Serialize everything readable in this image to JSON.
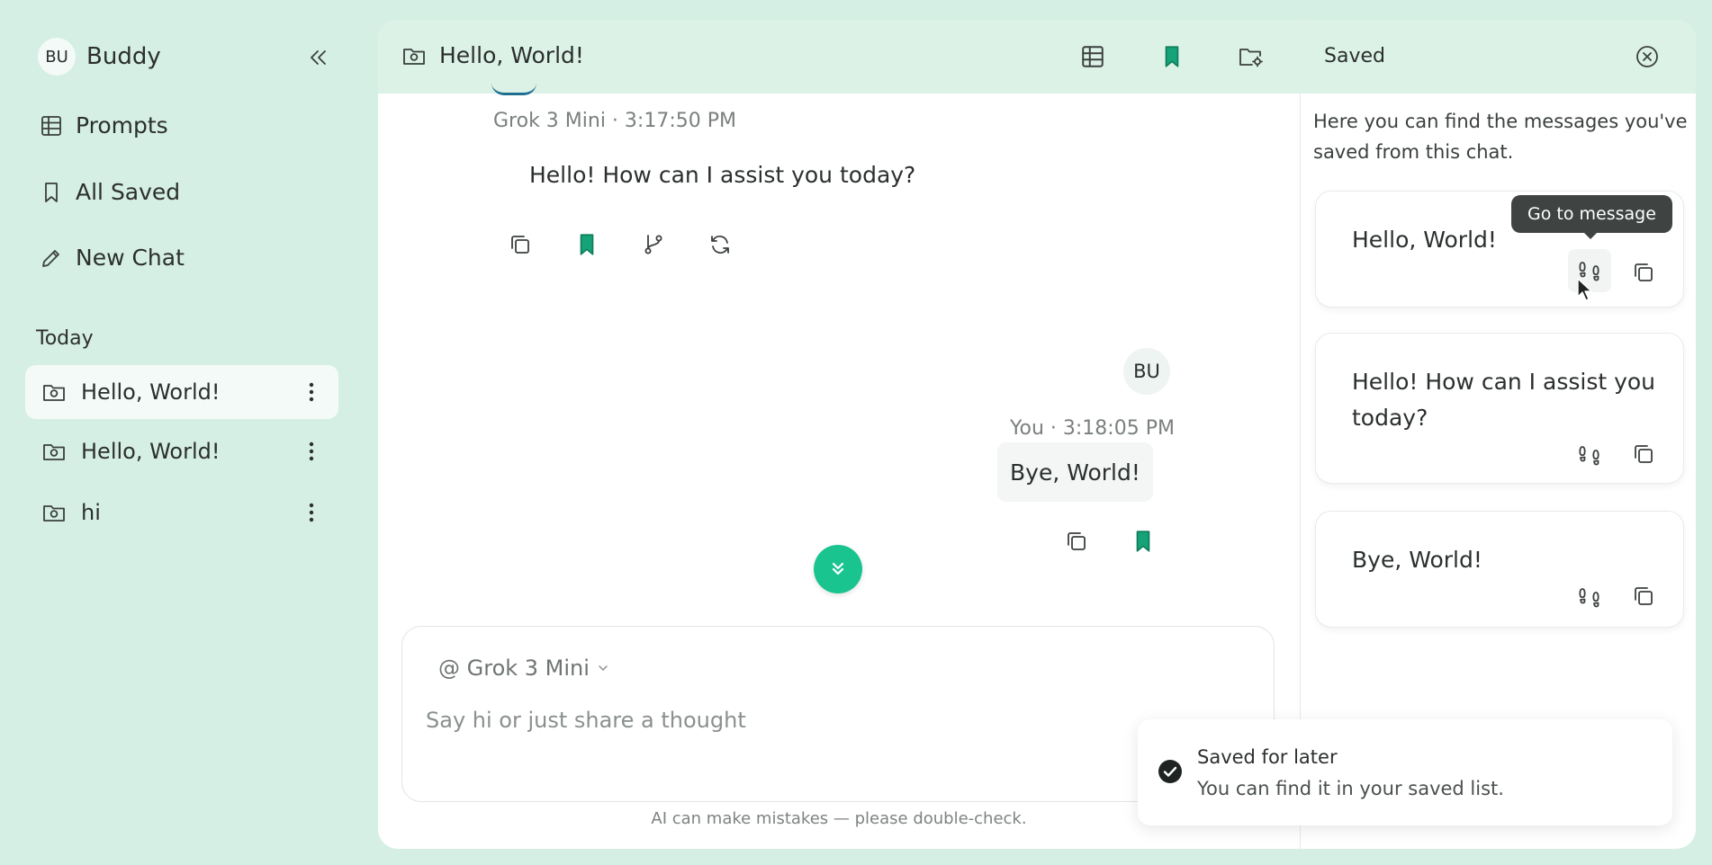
{
  "sidebar": {
    "avatar_initials": "BU",
    "app_name": "Buddy",
    "nav": [
      {
        "label": "Prompts",
        "icon": "table-icon"
      },
      {
        "label": "All Saved",
        "icon": "bookmark-icon"
      },
      {
        "label": "New Chat",
        "icon": "pencil-icon"
      }
    ],
    "section_title": "Today",
    "chats": [
      {
        "label": "Hello, World!",
        "active": true
      },
      {
        "label": "Hello, World!",
        "active": false
      },
      {
        "label": "hi",
        "active": false
      }
    ]
  },
  "chat": {
    "title": "Hello, World!",
    "messages": [
      {
        "meta": "Grok 3 Mini · 3:17:50 PM",
        "text": "Hello! How can I assist you today?",
        "role": "assistant"
      },
      {
        "meta": "You · 3:18:05 PM",
        "text": "Bye, World!",
        "role": "user",
        "avatar": "BU"
      }
    ],
    "composer": {
      "model": "@ Grok 3 Mini",
      "placeholder": "Say hi or just share a thought"
    },
    "disclaimer": "AI can make mistakes — please double-check."
  },
  "saved": {
    "title": "Saved",
    "description": "Here you can find the messages you've saved from this chat.",
    "items": [
      {
        "text": "Hello, World!"
      },
      {
        "text": "Hello! How can I assist you today?"
      },
      {
        "text": "Bye, World!"
      }
    ],
    "tooltip": "Go to message"
  },
  "toast": {
    "title": "Saved for later",
    "message": "You can find it in your saved list."
  },
  "colors": {
    "accent": "#19c48f",
    "background": "#d6efe4",
    "header": "#dcf2e7",
    "bookmark": "#15a377"
  }
}
